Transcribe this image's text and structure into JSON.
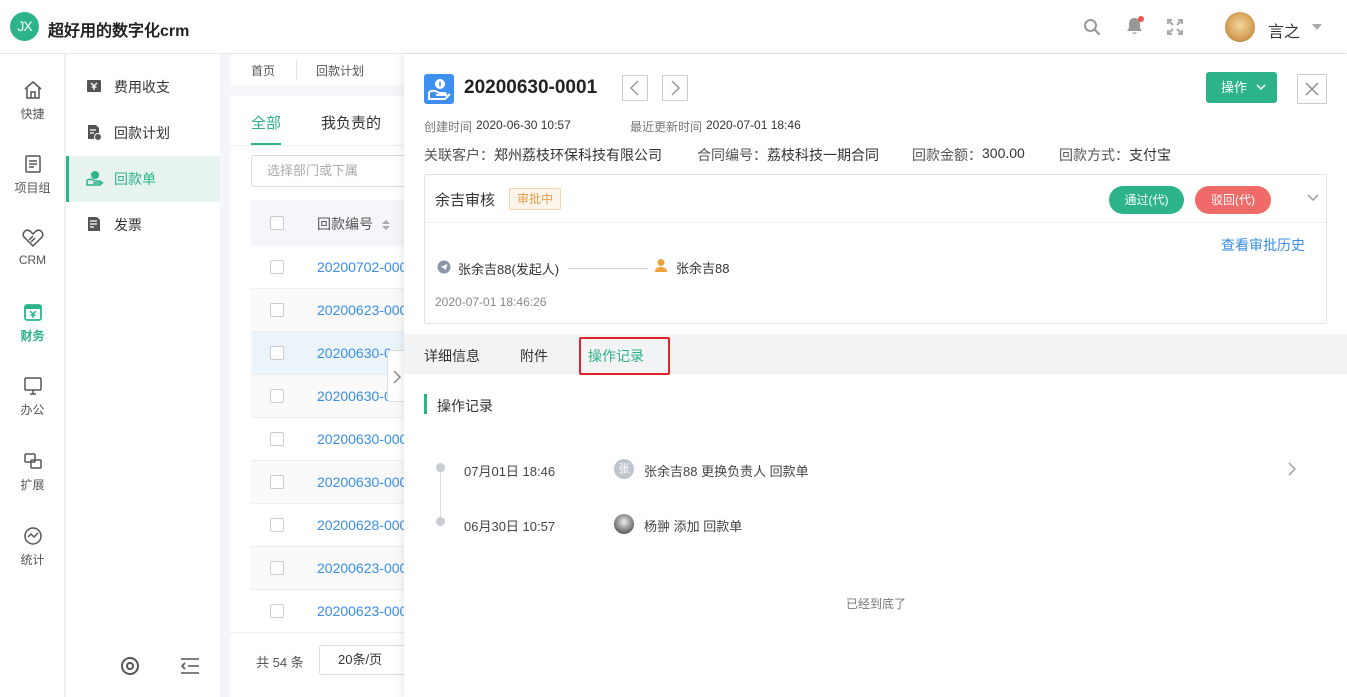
{
  "app": {
    "logo_text": "JX",
    "title": "超好用的数字化crm"
  },
  "topbar": {
    "icons": [
      "search-icon",
      "bell-icon",
      "expand-icon"
    ],
    "has_notification": true,
    "user_name": "言之"
  },
  "rail": {
    "items": [
      {
        "label": "快捷",
        "icon": "home-icon"
      },
      {
        "label": "项目组",
        "icon": "document-icon"
      },
      {
        "label": "CRM",
        "icon": "handshake-icon"
      },
      {
        "label": "财务",
        "icon": "finance-icon",
        "active": true
      },
      {
        "label": "办公",
        "icon": "monitor-icon"
      },
      {
        "label": "扩展",
        "icon": "extend-icon"
      },
      {
        "label": "统计",
        "icon": "chart-icon"
      }
    ],
    "accent": "#2db38a"
  },
  "sub_sidebar": {
    "items": [
      {
        "label": "费用收支",
        "icon": "expense-icon"
      },
      {
        "label": "回款计划",
        "icon": "plan-icon"
      },
      {
        "label": "回款单",
        "icon": "receipt-icon",
        "active": true
      },
      {
        "label": "发票",
        "icon": "invoice-icon"
      }
    ]
  },
  "list": {
    "breadcrumbs": [
      "首页",
      "回款计划"
    ],
    "tabs": [
      "全部",
      "我负责的"
    ],
    "dept_placeholder": "选择部门或下属",
    "column_header": "回款编号",
    "rows": [
      "20200702-000",
      "20200623-000",
      "20200630-0",
      "20200630-0",
      "20200630-000",
      "20200630-000",
      "20200628-000",
      "20200623-000",
      "20200623-000"
    ],
    "total": "共 54 条",
    "page_size": "20条/页"
  },
  "detail": {
    "number": "20200630-0001",
    "operate_label": "操作",
    "created_label": "创建时间",
    "created_value": "2020-06-30 10:57",
    "updated_label": "最近更新时间",
    "updated_value": "2020-07-01 18:46",
    "customer_label": "关联客户：",
    "customer_value": "郑州荔枝环保科技有限公司",
    "contract_label": "合同编号：",
    "contract_value": "荔枝科技一期合同",
    "amount_label": "回款金额：",
    "amount_value": "300.00",
    "method_label": "回款方式：",
    "method_value": "支付宝"
  },
  "approval": {
    "title": "余吉审核",
    "status": "审批中",
    "pass_label": "通过(代)",
    "reject_label": "驳回(代)",
    "history_link": "查看审批历史",
    "initiator": "张余吉88(发起人)",
    "approver": "张余吉88",
    "time": "2020-07-01 18:46:26"
  },
  "detail_tabs": [
    {
      "label": "详细信息"
    },
    {
      "label": "附件"
    },
    {
      "label": "操作记录",
      "active": true
    }
  ],
  "oplog": {
    "section_title": "操作记录",
    "entries": [
      {
        "time": "07月01日 18:46",
        "avatar_text": "张",
        "text": "张余吉88 更换负责人 回款单"
      },
      {
        "time": "06月30日 10:57",
        "avatar_text": "",
        "text": "杨翀 添加 回款单"
      }
    ],
    "end_text": "已经到底了"
  }
}
